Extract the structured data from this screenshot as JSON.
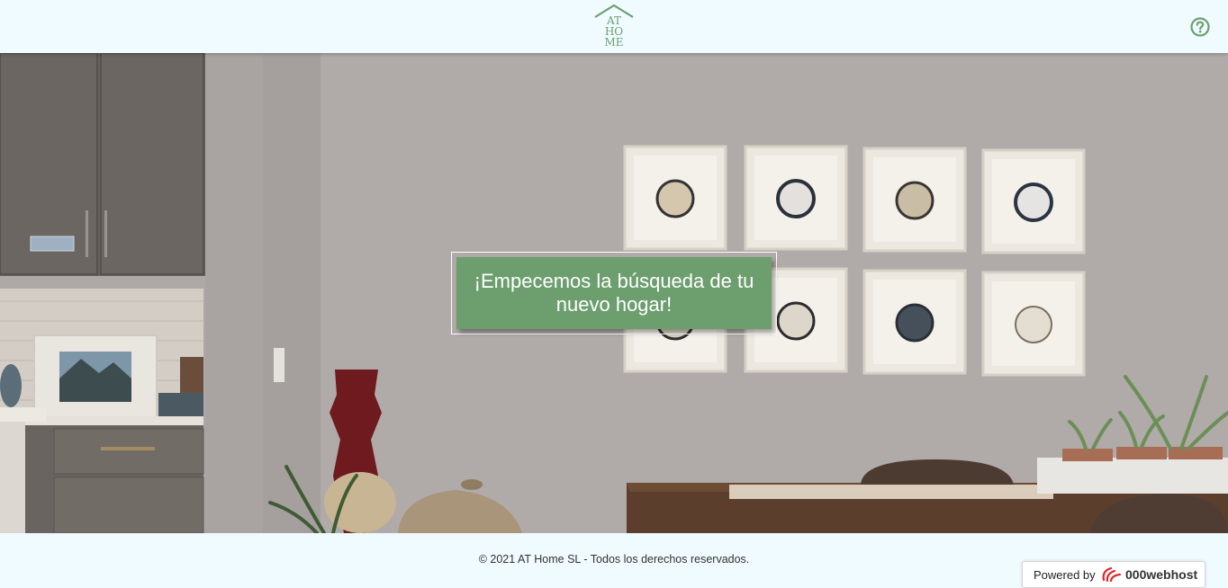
{
  "header": {
    "logo_lines": [
      "AT",
      "HO",
      "ME"
    ],
    "logo_icon": "house-roof-icon",
    "help_icon": "question-circle-icon"
  },
  "hero": {
    "cta_label": "¡Empecemos la búsqueda de tu nuevo hogar!"
  },
  "footer": {
    "copyright": "© 2021 AT Home SL - Todos los derechos reservados.",
    "powered_by": "Powered by",
    "brand": "000webhost"
  },
  "colors": {
    "accent": "#6c9e6e",
    "background": "#f0fbff"
  }
}
